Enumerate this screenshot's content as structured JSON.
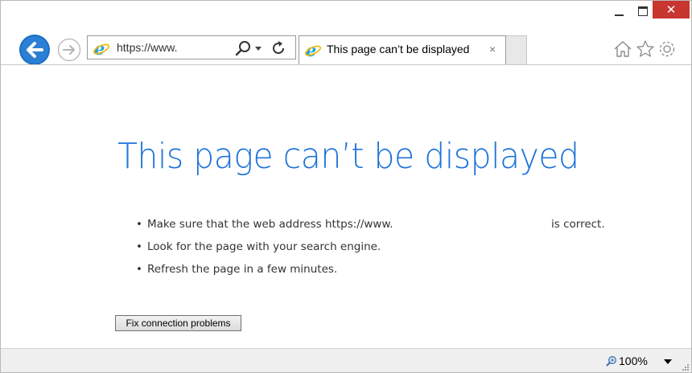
{
  "window": {
    "controls": {
      "minimize_icon": "minimize-icon",
      "maximize_icon": "maximize-icon",
      "close_glyph": "✕"
    }
  },
  "toolbar": {
    "back_icon": "back-arrow-icon",
    "forward_icon": "forward-arrow-icon",
    "address": {
      "value": "https://www.",
      "browser_icon": "ie-logo-icon"
    },
    "search_icon": "search-icon",
    "refresh_icon": "refresh-icon",
    "right_icons": [
      "home-icon",
      "favorites-star-icon",
      "settings-gear-icon"
    ]
  },
  "tab": {
    "title": "This page can’t be displayed",
    "close_glyph": "×"
  },
  "page": {
    "heading": "This page can’t be displayed",
    "bullet_char": "•",
    "bullets": [
      {
        "text": "Make sure that the web address https://www.",
        "suffix": "is correct."
      },
      {
        "text": "Look for the page with your search engine."
      },
      {
        "text": "Refresh the page in a few minutes."
      }
    ],
    "fix_button_label": "Fix connection problems"
  },
  "statusbar": {
    "zoom": "100%"
  },
  "colors": {
    "accent_blue": "#1e73d8",
    "close_red": "#c7372f",
    "back_button_blue": "#1b6ec2"
  }
}
